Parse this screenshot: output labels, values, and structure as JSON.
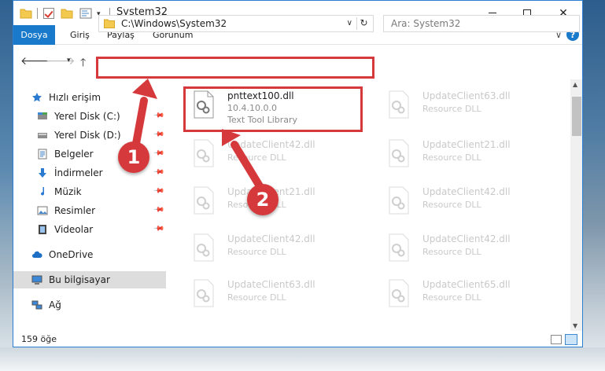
{
  "window": {
    "title": "System32"
  },
  "ribbon": {
    "tabs": [
      {
        "label": "Dosya"
      },
      {
        "label": "Giriş"
      },
      {
        "label": "Paylaş"
      },
      {
        "label": "Görünüm"
      }
    ],
    "expand": "∨",
    "help": "?"
  },
  "nav": {
    "address": "C:\\Windows\\System32",
    "search_placeholder": "Ara: System32"
  },
  "sidebar": {
    "items": [
      {
        "label": "Hızlı erişim",
        "icon": "star-icon"
      },
      {
        "label": "Yerel Disk (C:)",
        "icon": "drive-icon"
      },
      {
        "label": "Yerel Disk (D:)",
        "icon": "drive-icon"
      },
      {
        "label": "Belgeler",
        "icon": "documents-icon"
      },
      {
        "label": "İndirmeler",
        "icon": "download-icon"
      },
      {
        "label": "Müzik",
        "icon": "music-icon"
      },
      {
        "label": "Resimler",
        "icon": "pictures-icon"
      },
      {
        "label": "Videolar",
        "icon": "video-icon"
      },
      {
        "label": "OneDrive",
        "icon": "cloud-icon"
      },
      {
        "label": "Bu bilgisayar",
        "icon": "computer-icon"
      },
      {
        "label": "Ağ",
        "icon": "network-icon"
      }
    ]
  },
  "files": {
    "highlighted": {
      "name": "pnttext100.dll",
      "version": "10.4.10.0.0",
      "description": "Text Tool Library"
    },
    "items": [
      {
        "name": "UpdateClient63.dll",
        "desc": "Resource DLL"
      },
      {
        "name": "UpdateClient42.dll",
        "desc": "Resource DLL"
      },
      {
        "name": "UpdateClient21.dll",
        "desc": "Resource DLL"
      },
      {
        "name": "UpdateClient21.dll",
        "desc": "Resource DLL"
      },
      {
        "name": "UpdateClient42.dll",
        "desc": "Resource DLL"
      },
      {
        "name": "UpdateClient42.dll",
        "desc": "Resource DLL"
      },
      {
        "name": "UpdateClient42.dll",
        "desc": "Resource DLL"
      },
      {
        "name": "UpdateClient63.dll",
        "desc": "Resource DLL"
      },
      {
        "name": "UpdateClient65.dll",
        "desc": "Resource DLL"
      }
    ]
  },
  "status": {
    "count": "159 öğe"
  },
  "annotations": {
    "badge1": "1",
    "badge2": "2",
    "color": "#d6393b"
  },
  "colors": {
    "accent": "#1979ca"
  }
}
